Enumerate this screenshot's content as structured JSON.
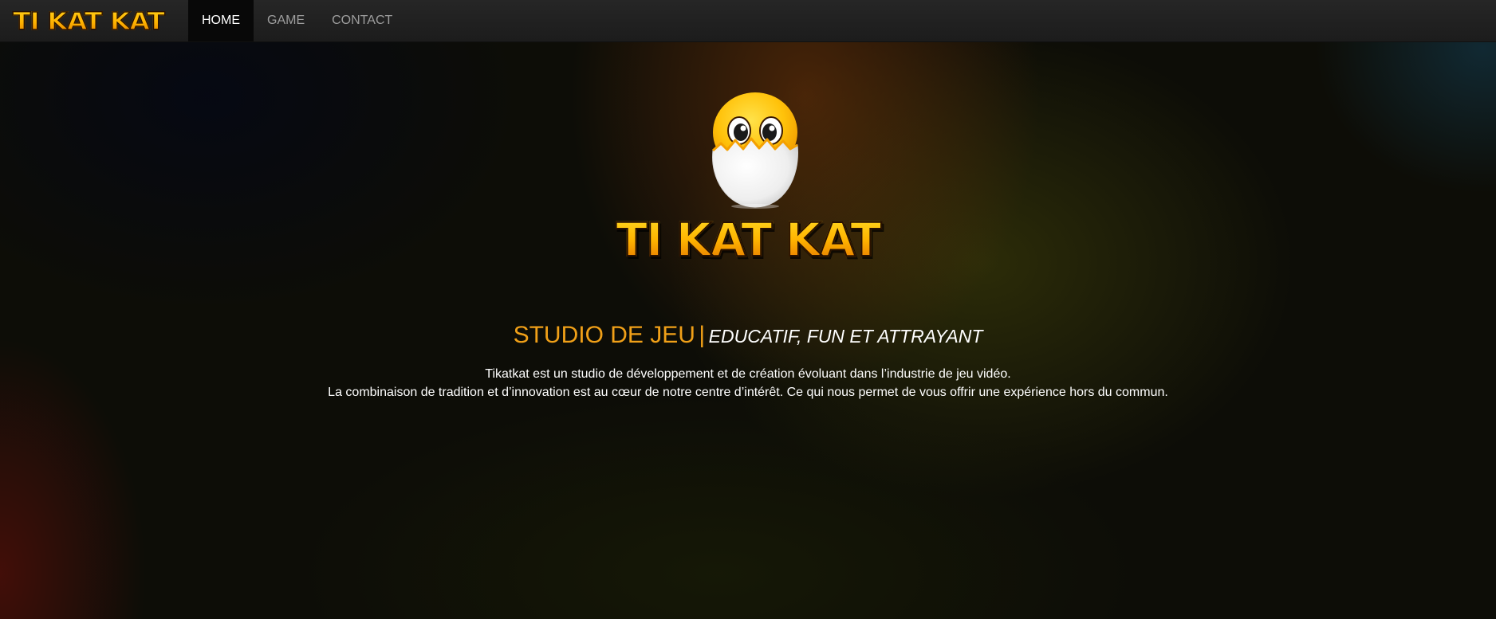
{
  "navbar": {
    "brand": "TI KAT KAT",
    "items": [
      {
        "label": "HOME",
        "active": true
      },
      {
        "label": "GAME",
        "active": false
      },
      {
        "label": "CONTACT",
        "active": false
      }
    ]
  },
  "hero": {
    "logo_text": "TI KAT KAT",
    "mascot_icon": "hatching-chick-icon",
    "tagline": {
      "main": "STUDIO DE JEU",
      "separator": "|",
      "sub": "EDUCATIF, FUN ET ATTRAYANT"
    },
    "description": {
      "line1": "Tikatkat est un studio de développement et de création évoluant dans l’industrie de jeu vidéo.",
      "line2": "La combinaison de tradition et d’innovation est au cœur de notre centre d’intérêt. Ce qui nous permet de vous offrir une expérience hors du commun."
    }
  },
  "colors": {
    "accent": "#f0a018",
    "navbar_bg": "#222222",
    "nav_active_bg": "#080808",
    "nav_text": "#9d9d9d",
    "logo_yellow": "#ffb400"
  }
}
